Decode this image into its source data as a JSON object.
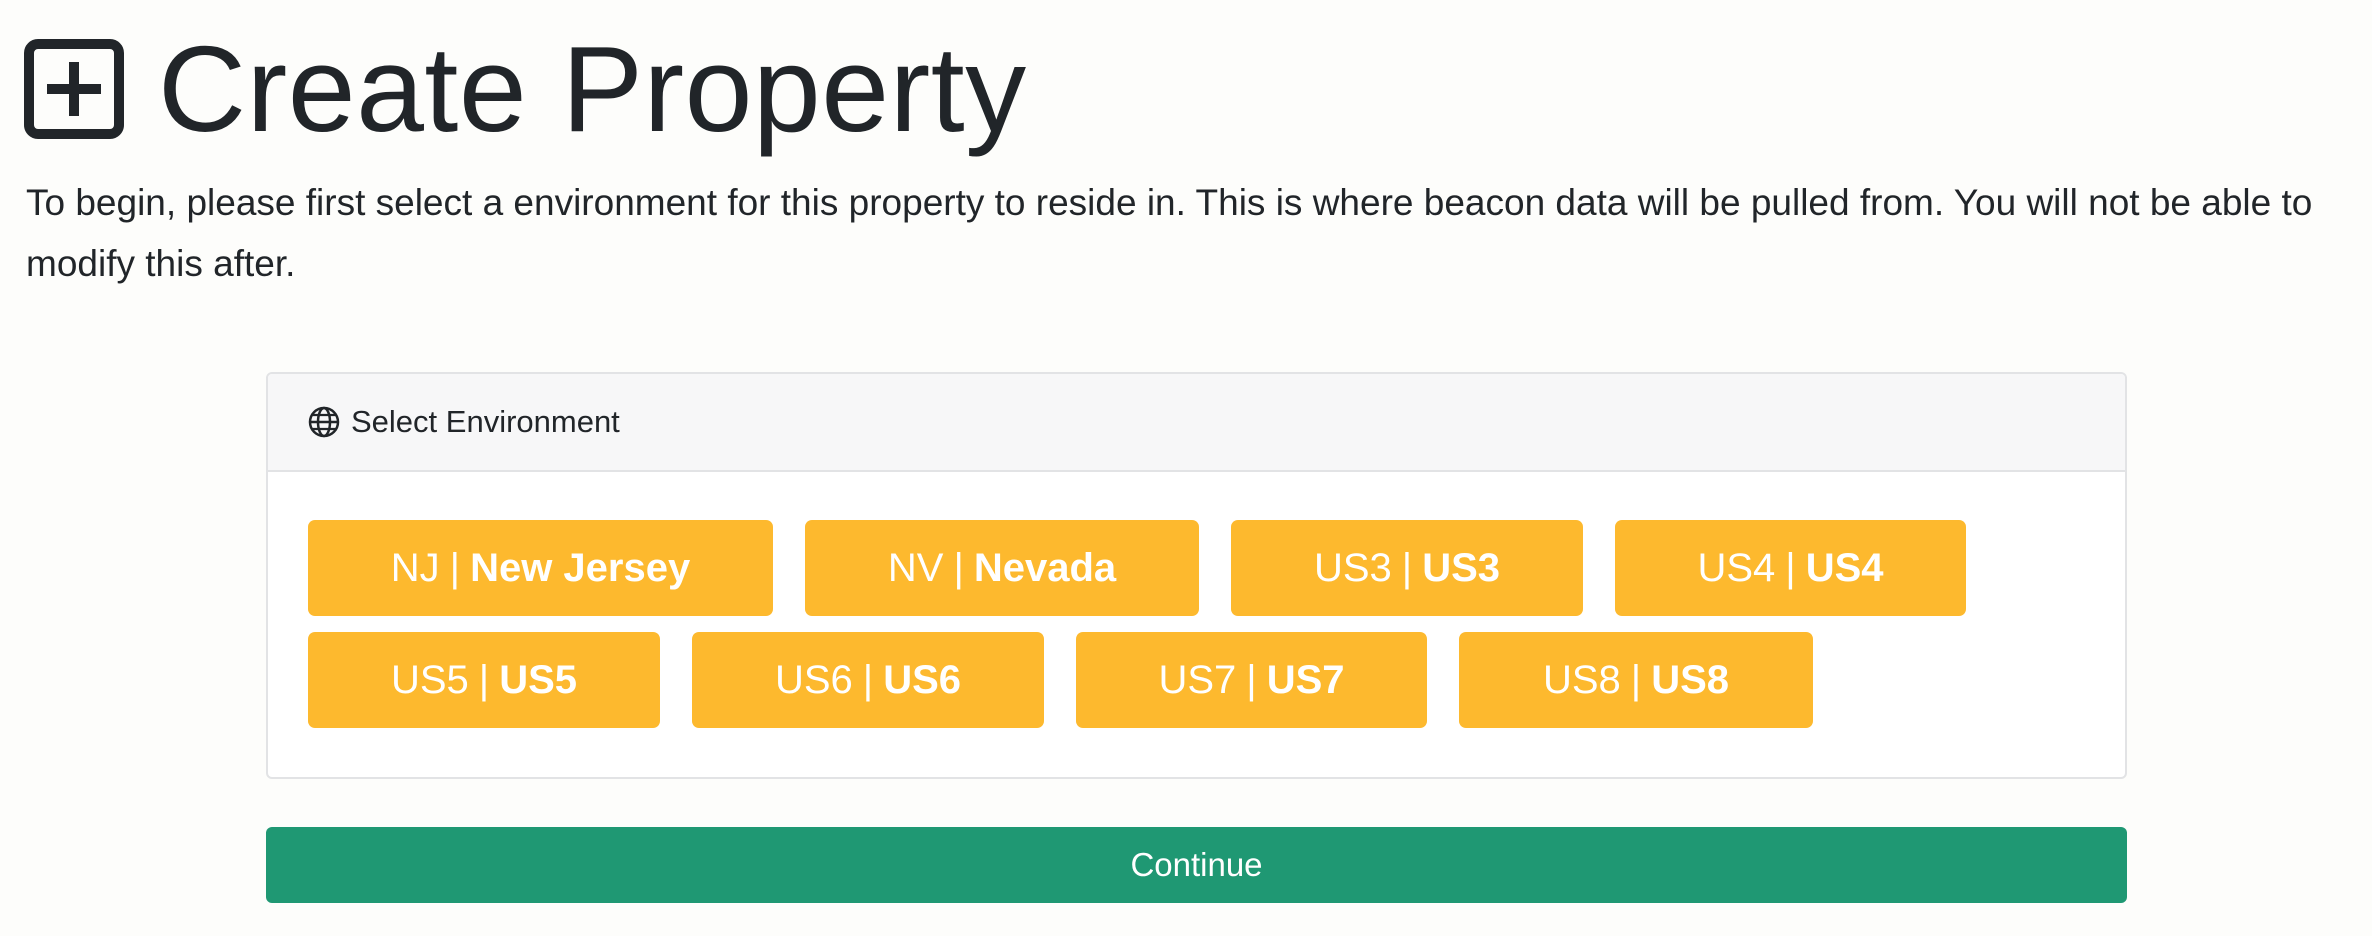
{
  "header": {
    "icon": "plus-square-icon",
    "title": "Create Property"
  },
  "intro_text": "To begin, please first select a environment for this property to reside in. This is where beacon data will be pulled from. You will not be able to modify this after.",
  "card": {
    "icon": "globe-icon",
    "title": "Select Environment"
  },
  "environments": [
    {
      "code": "NJ",
      "sep": "|",
      "name": "New Jersey"
    },
    {
      "code": "NV",
      "sep": "|",
      "name": "Nevada"
    },
    {
      "code": "US3",
      "sep": "|",
      "name": "US3"
    },
    {
      "code": "US4",
      "sep": "|",
      "name": "US4"
    },
    {
      "code": "US5",
      "sep": "|",
      "name": "US5"
    },
    {
      "code": "US6",
      "sep": "|",
      "name": "US6"
    },
    {
      "code": "US7",
      "sep": "|",
      "name": "US7"
    },
    {
      "code": "US8",
      "sep": "|",
      "name": "US8"
    }
  ],
  "continue_label": "Continue",
  "colors": {
    "env_button": "#fdb92e",
    "continue_button": "#1f9873",
    "text": "#212529"
  }
}
